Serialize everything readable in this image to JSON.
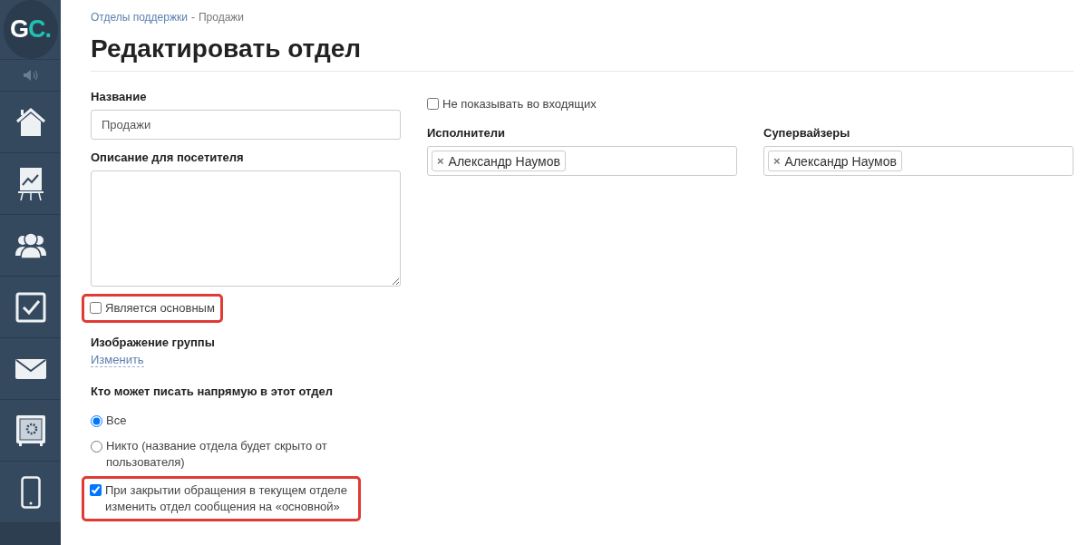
{
  "sidebar": {
    "logo": {
      "primary": "G",
      "accent": "C."
    },
    "items": [
      {
        "kind": "speaker",
        "selected": false
      },
      {
        "kind": "home",
        "selected": false
      },
      {
        "kind": "chart",
        "selected": false
      },
      {
        "kind": "users",
        "selected": false
      },
      {
        "kind": "tasks",
        "selected": false
      },
      {
        "kind": "mail",
        "selected": false
      },
      {
        "kind": "safe",
        "selected": false
      },
      {
        "kind": "phone",
        "selected": false
      }
    ]
  },
  "breadcrumbs": [
    {
      "label": "Отделы поддержки",
      "link": true
    },
    {
      "label": "-",
      "link": false
    },
    {
      "label": "Продажи",
      "link": false
    }
  ],
  "title": "Редактировать отдел",
  "name_field": {
    "label": "Название",
    "value": "Продажи"
  },
  "description_field": {
    "label": "Описание для посетителя"
  },
  "is_main": {
    "label": "Является основным",
    "checked": false,
    "highlighted": true
  },
  "group_image": {
    "label": "Изображение группы",
    "link": "Изменить"
  },
  "who_can_write": {
    "label": "Кто может писать напрямую в этот отдел",
    "options": [
      {
        "label": "Все",
        "selected": true
      },
      {
        "label": "Никто (название отдела будет скрыто от пользователя)",
        "selected": false
      }
    ]
  },
  "on_close": {
    "label": "При закрытии обращения в текущем отделе изменить отдел сообщения на «основной»",
    "checked": true,
    "highlighted": true
  },
  "hide_inbox": {
    "label": "Не показывать во входящих",
    "checked": false
  },
  "assignees": {
    "label": "Исполнители",
    "tags": [
      {
        "remove": "×",
        "name": "Александр Наумов"
      }
    ]
  },
  "supervisors": {
    "label": "Супервайзеры",
    "tags": [
      {
        "remove": "×",
        "name": "Александр Наумов"
      }
    ]
  }
}
